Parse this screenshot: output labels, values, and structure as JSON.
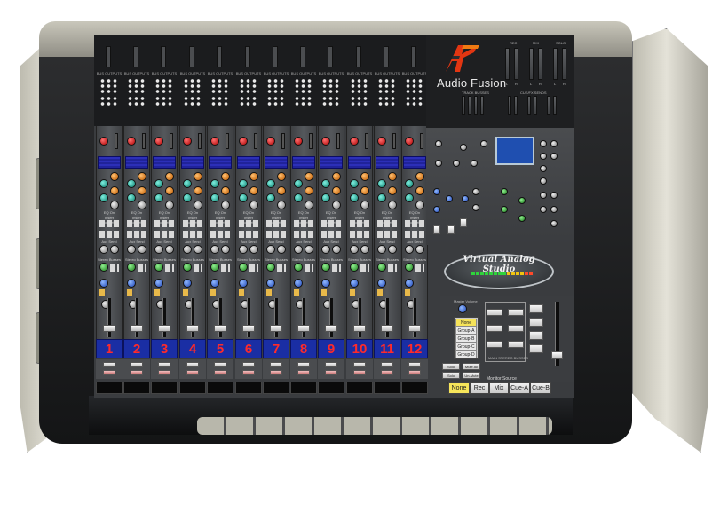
{
  "brand": {
    "name": "Audio Fusion",
    "logo_letters": "AF",
    "accent": "#e03010"
  },
  "console": {
    "badge_text": "Virtual Analog Studio",
    "bus_outputs_label": "BUS OUTPUTS",
    "track_busses_label": "TRACK BUSSES",
    "cue_sends_label": "CUE/FX SENDS",
    "meter_labels": [
      "REC",
      "MIX",
      "SOLO"
    ],
    "mini_lr": [
      "L",
      "R",
      "L",
      "R",
      "L",
      "R"
    ],
    "master_volume_label": "Master Volume",
    "master_stereo_label": "MAIN STEREO BUSSES"
  },
  "channels": [
    "1",
    "2",
    "3",
    "4",
    "5",
    "6",
    "7",
    "8",
    "9",
    "10",
    "11",
    "12"
  ],
  "strip_labels": {
    "eq_label": "EQ On",
    "insert_label": "Insert Send/Return",
    "aux_label": "Aux Send",
    "stereo_label": "Stereo Busses"
  },
  "groups": [
    "None",
    "Group-A",
    "Group-B",
    "Group-C",
    "Group-D"
  ],
  "solo_mute": {
    "solo_clear": "Solo Clear",
    "mute_all": "Mute All",
    "solo_save": "Solo Save",
    "un_mute_all": "Un-Mute All"
  },
  "monitor_source": {
    "label": "Monitor Source",
    "buttons": [
      "None",
      "Rec",
      "Mix",
      "Cue-A",
      "Cue-B"
    ],
    "active": "None"
  },
  "colors": {
    "channel_number": "#ff2a2a",
    "channel_strip_bg": "#1a2ea4",
    "selected": "#f6e55a"
  }
}
